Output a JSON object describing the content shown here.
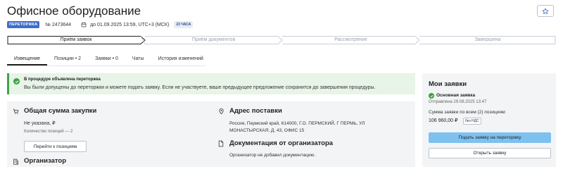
{
  "header": {
    "title": "Офисное оборудование",
    "status_badge": "ПЕРЕТОРЖКА",
    "number": "№ 2473644",
    "deadline": "до 01.09.2025 13:59, UTC+3 (МСК)",
    "hours_badge": "23 ЧАСА"
  },
  "stepper": {
    "steps": [
      {
        "label": "Приём заявок",
        "state": "active"
      },
      {
        "label": "Приём документов",
        "state": "inactive"
      },
      {
        "label": "Рассмотрение",
        "state": "inactive"
      },
      {
        "label": "Завершена",
        "state": "inactive"
      }
    ]
  },
  "tabs": [
    {
      "label": "Извещение",
      "active": true
    },
    {
      "label": "Позиции • 2",
      "active": false
    },
    {
      "label": "Заявки • 0",
      "active": false
    },
    {
      "label": "Чаты",
      "active": false
    },
    {
      "label": "История изменений",
      "active": false
    }
  ],
  "notice": {
    "title": "В процедуре объявлена переторжка",
    "text": "Вы были допущены до переторжки и можете подать заявку. Если не участвуете, ваше предыдущее предложение сохранится до завершения процедуры."
  },
  "purchase": {
    "title": "Общая сумма закупки",
    "amount": "Не указана, ₽",
    "positions_count": "Количество позиций — 2",
    "goto_button": "Перейти к позициям",
    "organizer_title": "Организатор"
  },
  "delivery": {
    "title": "Адрес поставки",
    "address_line1": "Россия, Пермский край, 614000, Г.О. ПЕРМСКИЙ, Г ПЕРМЬ, УЛ",
    "address_line2": "МОНАСТЫРСКАЯ, Д. 43, ОФИС 15"
  },
  "docs": {
    "title": "Документация от организатора",
    "text": "Организатор не добавил документацию."
  },
  "my_bids": {
    "title": "Мои заявки",
    "main_label": "Основная заявка",
    "sent": "Отправлена 29.08.2025 13:47",
    "sum_label": "Сумма заявки по всем (2) позициям:",
    "sum_value": "106 960,00 ₽",
    "vat": "без НДС",
    "submit_button": "Подать заявку на переторжку",
    "open_button": "Открыть заявку"
  },
  "colors": {
    "accent_blue": "#3d6ec9",
    "success_green": "#3aa447",
    "notice_bg": "#e7f4e7",
    "primary_button": "#7ec1ef",
    "panel_bg": "#f3f4f6"
  },
  "icons": [
    "star-icon",
    "calendar-icon",
    "check-circle-icon",
    "cart-icon",
    "location-icon",
    "document-icon",
    "building-icon"
  ]
}
